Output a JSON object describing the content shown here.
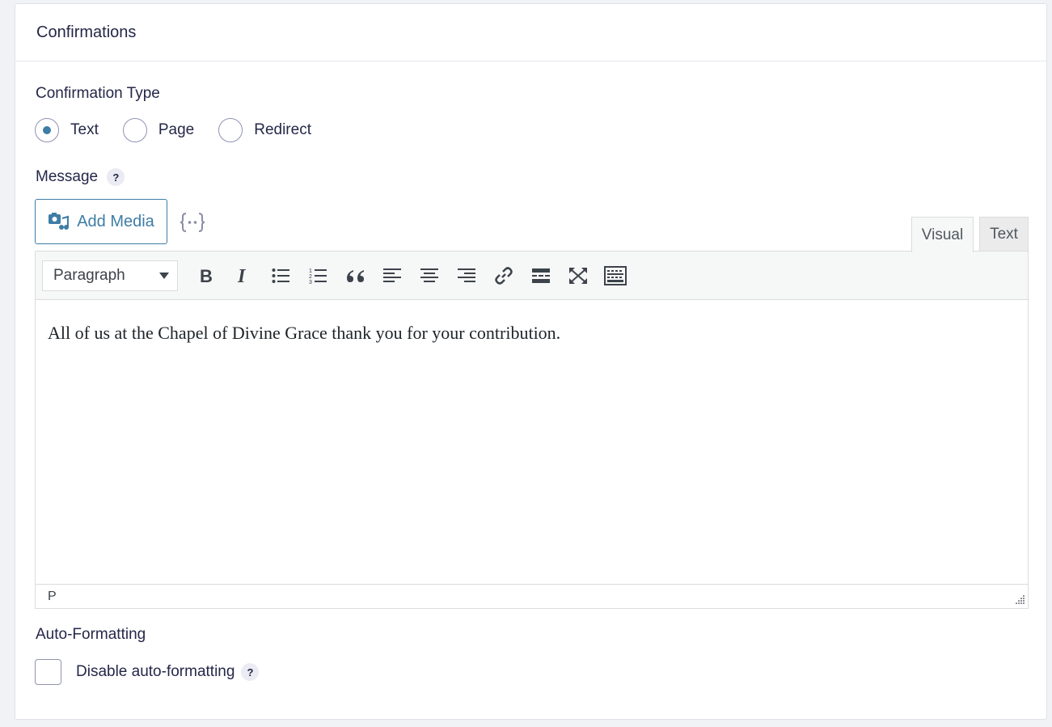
{
  "panel": {
    "title": "Confirmations"
  },
  "confirmation_type": {
    "label": "Confirmation Type",
    "options": [
      {
        "label": "Text",
        "checked": true
      },
      {
        "label": "Page",
        "checked": false
      },
      {
        "label": "Redirect",
        "checked": false
      }
    ]
  },
  "message": {
    "label": "Message",
    "help": "?",
    "add_media_label": "Add Media",
    "tabs": {
      "visual": "Visual",
      "text": "Text"
    },
    "format_select": "Paragraph",
    "content": "All of us at the Chapel of Divine Grace thank you for your contribution.",
    "status_path": "P"
  },
  "auto_formatting": {
    "label": "Auto-Formatting",
    "checkbox_label": "Disable auto-formatting",
    "help": "?"
  },
  "colors": {
    "accent": "#3e7da6",
    "text": "#242748"
  }
}
